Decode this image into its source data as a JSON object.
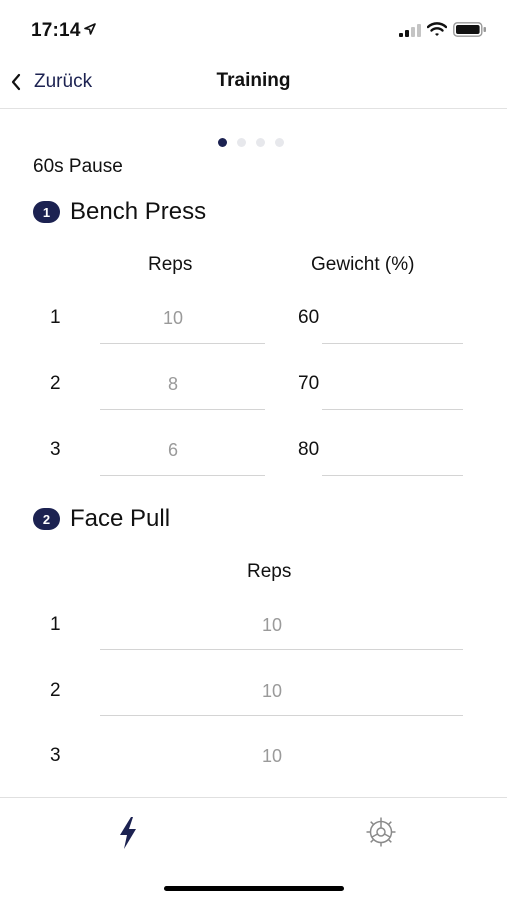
{
  "status_bar": {
    "time": "17:14",
    "icons": [
      "location-icon",
      "signal-icon",
      "wifi-icon",
      "battery-icon"
    ]
  },
  "nav": {
    "back_label": "Zurück",
    "title": "Training"
  },
  "pager": {
    "pages": 4,
    "active": 1
  },
  "pause_label": "60s Pause",
  "exercises": [
    {
      "number": "1",
      "name": "Bench Press",
      "col_reps": "Reps",
      "col_weight": "Gewicht (%)",
      "sets": [
        {
          "n": "1",
          "reps": "10",
          "weight": "60"
        },
        {
          "n": "2",
          "reps": "8",
          "weight": "70"
        },
        {
          "n": "3",
          "reps": "6",
          "weight": "80"
        }
      ]
    },
    {
      "number": "2",
      "name": "Face Pull",
      "col_reps": "Reps",
      "sets": [
        {
          "n": "1",
          "reps": "10"
        },
        {
          "n": "2",
          "reps": "10"
        },
        {
          "n": "3",
          "reps": "10"
        }
      ]
    }
  ],
  "tabs": [
    {
      "icon": "lightning-icon",
      "active": true
    },
    {
      "icon": "gear-icon",
      "active": false
    }
  ],
  "colors": {
    "accent": "#1c2251",
    "muted_text": "#9a9a9a",
    "divider": "#d4d4d4"
  }
}
